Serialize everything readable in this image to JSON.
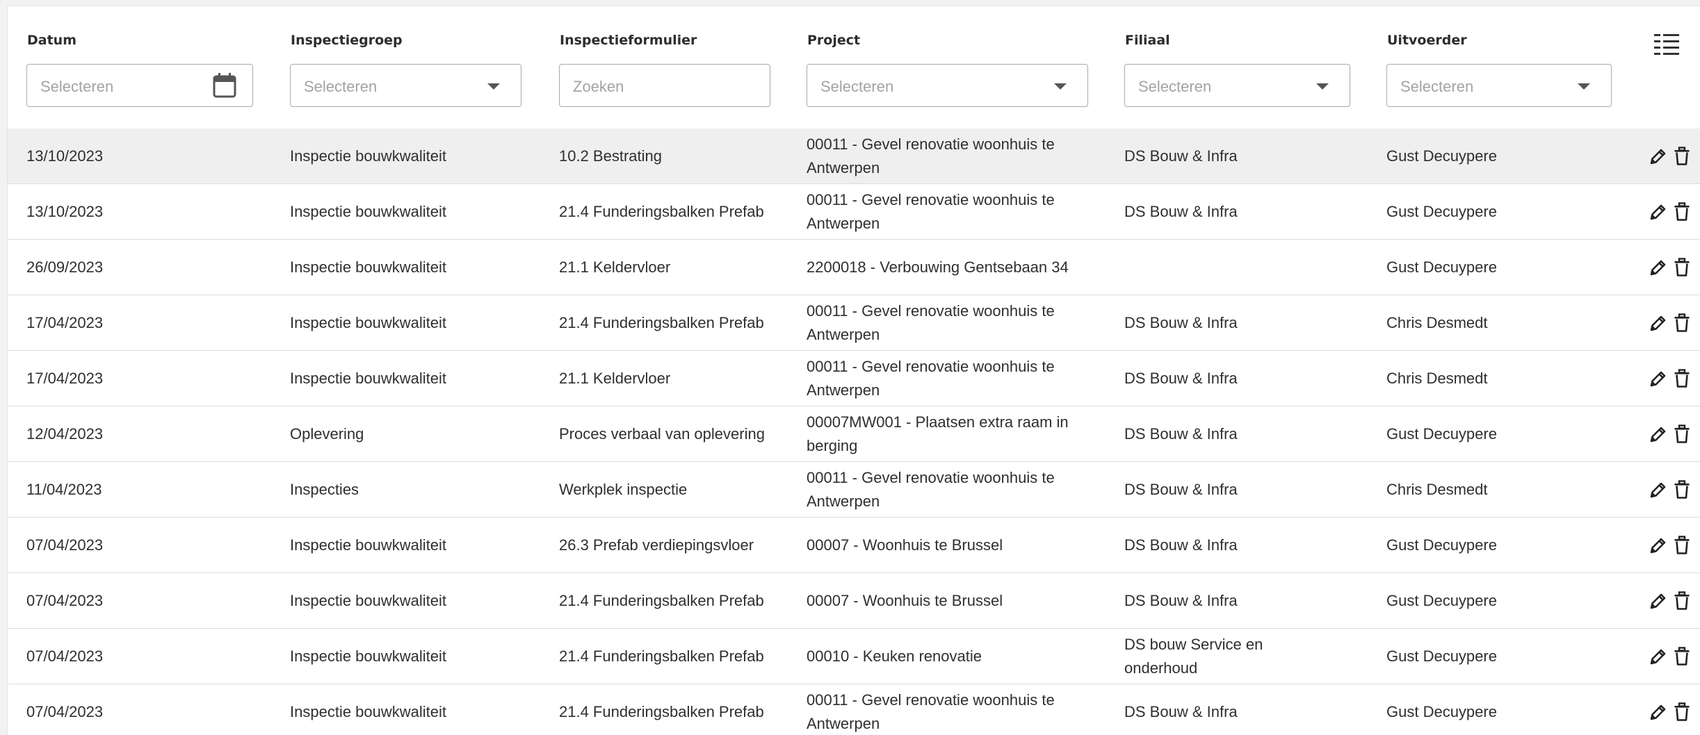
{
  "columns": {
    "datum": {
      "label": "Datum",
      "placeholder": "Selecteren"
    },
    "inspectiegroep": {
      "label": "Inspectiegroep",
      "placeholder": "Selecteren"
    },
    "inspectieformulier": {
      "label": "Inspectieformulier",
      "placeholder": "Zoeken"
    },
    "project": {
      "label": "Project",
      "placeholder": "Selecteren"
    },
    "filiaal": {
      "label": "Filiaal",
      "placeholder": "Selecteren"
    },
    "uitvoerder": {
      "label": "Uitvoerder",
      "placeholder": "Selecteren"
    }
  },
  "icons": {
    "calendar": "calendar-icon",
    "dropdown": "caret-down-icon",
    "column_menu": "column-list-icon",
    "edit": "pencil-icon",
    "delete": "trash-icon"
  },
  "rows": [
    {
      "datum": "13/10/2023",
      "inspectiegroep": "Inspectie bouwkwaliteit",
      "inspectieformulier": "10.2 Bestrating",
      "project": "00011 - Gevel renovatie woonhuis te Antwerpen",
      "filiaal": "DS Bouw & Infra",
      "uitvoerder": "Gust Decuypere"
    },
    {
      "datum": "13/10/2023",
      "inspectiegroep": "Inspectie bouwkwaliteit",
      "inspectieformulier": "21.4 Funderingsbalken Prefab",
      "project": "00011 - Gevel renovatie woonhuis te Antwerpen",
      "filiaal": "DS Bouw & Infra",
      "uitvoerder": "Gust Decuypere"
    },
    {
      "datum": "26/09/2023",
      "inspectiegroep": "Inspectie bouwkwaliteit",
      "inspectieformulier": "21.1 Keldervloer",
      "project": "2200018 - Verbouwing Gentsebaan 34",
      "filiaal": "",
      "uitvoerder": "Gust Decuypere"
    },
    {
      "datum": "17/04/2023",
      "inspectiegroep": "Inspectie bouwkwaliteit",
      "inspectieformulier": "21.4 Funderingsbalken Prefab",
      "project": "00011 - Gevel renovatie woonhuis te Antwerpen",
      "filiaal": "DS Bouw & Infra",
      "uitvoerder": "Chris Desmedt"
    },
    {
      "datum": "17/04/2023",
      "inspectiegroep": "Inspectie bouwkwaliteit",
      "inspectieformulier": "21.1 Keldervloer",
      "project": "00011 - Gevel renovatie woonhuis te Antwerpen",
      "filiaal": "DS Bouw & Infra",
      "uitvoerder": "Chris Desmedt"
    },
    {
      "datum": "12/04/2023",
      "inspectiegroep": "Oplevering",
      "inspectieformulier": "Proces verbaal van oplevering",
      "project": "00007MW001 - Plaatsen extra raam in berging",
      "filiaal": "DS Bouw & Infra",
      "uitvoerder": "Gust Decuypere"
    },
    {
      "datum": "11/04/2023",
      "inspectiegroep": "Inspecties",
      "inspectieformulier": "Werkplek inspectie",
      "project": "00011 - Gevel renovatie woonhuis te Antwerpen",
      "filiaal": "DS Bouw & Infra",
      "uitvoerder": "Chris Desmedt"
    },
    {
      "datum": "07/04/2023",
      "inspectiegroep": "Inspectie bouwkwaliteit",
      "inspectieformulier": "26.3 Prefab verdiepingsvloer",
      "project": "00007 - Woonhuis te Brussel",
      "filiaal": "DS Bouw & Infra",
      "uitvoerder": "Gust Decuypere"
    },
    {
      "datum": "07/04/2023",
      "inspectiegroep": "Inspectie bouwkwaliteit",
      "inspectieformulier": "21.4 Funderingsbalken Prefab",
      "project": "00007 - Woonhuis te Brussel",
      "filiaal": "DS Bouw & Infra",
      "uitvoerder": "Gust Decuypere"
    },
    {
      "datum": "07/04/2023",
      "inspectiegroep": "Inspectie bouwkwaliteit",
      "inspectieformulier": "21.4 Funderingsbalken Prefab",
      "project": "00010 - Keuken renovatie",
      "filiaal": "DS bouw Service en onderhoud",
      "uitvoerder": "Gust Decuypere"
    },
    {
      "datum": "07/04/2023",
      "inspectiegroep": "Inspectie bouwkwaliteit",
      "inspectieformulier": "21.4 Funderingsbalken Prefab",
      "project": "00011 - Gevel renovatie woonhuis te Antwerpen",
      "filiaal": "DS Bouw & Infra",
      "uitvoerder": "Gust Decuypere"
    }
  ]
}
